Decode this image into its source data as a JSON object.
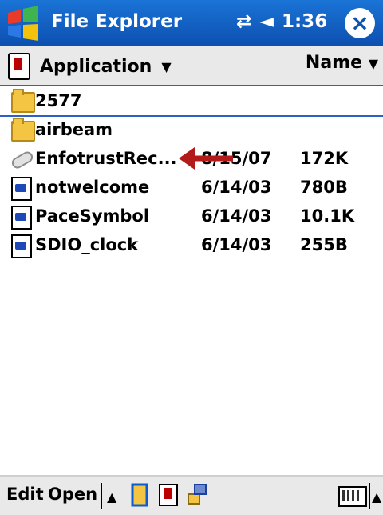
{
  "titlebar": {
    "app_title": "File Explorer",
    "status_time": "1:36",
    "close_icon": "close-icon"
  },
  "header": {
    "folder_label": "Application",
    "sort_label": "Name"
  },
  "files": [
    {
      "name": "2577",
      "date": "",
      "size": "",
      "icon": "folder-icon",
      "selected": true
    },
    {
      "name": "airbeam",
      "date": "",
      "size": "",
      "icon": "folder-icon",
      "selected": false
    },
    {
      "name": "EnfotrustRec...",
      "date": "8/15/07",
      "size": "172K",
      "icon": "shortcut-icon",
      "selected": false
    },
    {
      "name": "notwelcome",
      "date": "6/14/03",
      "size": "780B",
      "icon": "file-icon",
      "selected": false
    },
    {
      "name": "PaceSymbol",
      "date": "6/14/03",
      "size": "10.1K",
      "icon": "file-icon",
      "selected": false
    },
    {
      "name": "SDIO_clock",
      "date": "6/14/03",
      "size": "255B",
      "icon": "file-icon",
      "selected": false
    }
  ],
  "toolbar": {
    "edit_label": "Edit",
    "open_label": "Open"
  },
  "colors": {
    "titlebar": "#0c4fb0",
    "arrow": "#b31b1b",
    "selection": "#2d5fc7"
  }
}
